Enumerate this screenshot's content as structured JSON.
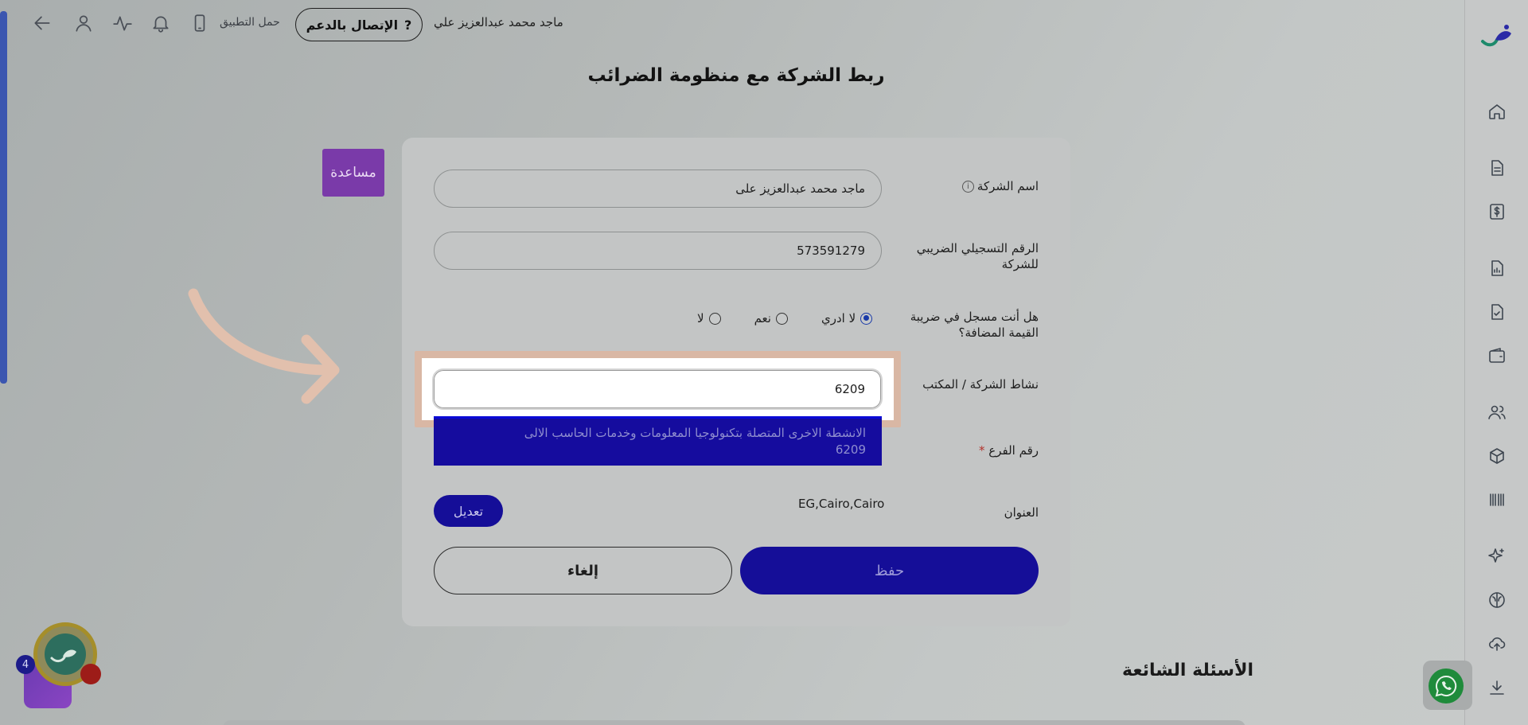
{
  "topbar": {
    "user_name": "ماجد محمد عبدالعزيز علي",
    "support_label": "الإتصال بالدعم",
    "support_icon": "?",
    "download_app_label": "حمل التطبيق"
  },
  "page": {
    "title": "ربط الشركة مع منظومة الضرائب",
    "help_label": "مساعدة"
  },
  "form": {
    "company_name_label": "اسم الشركة",
    "company_name_value": "ماجد محمد عبدالعزيز على",
    "tax_number_label_1": "الرقم التسجيلي الضريبي",
    "tax_number_label_2": "للشركة",
    "tax_number_value": "573591279",
    "vat_label_1": "هل أنت مسجل في ضريبة",
    "vat_label_2": "القيمة المضافة؟",
    "vat_options": [
      "لا ادري",
      "نعم",
      "لا"
    ],
    "vat_selected": "لا ادري",
    "activity_label": "نشاط الشركة / المكتب",
    "activity_value": "6209",
    "activity_option_text": "الانشطة الاخرى المتصلة بتكنولوجيا المعلومات وخدمات الحاسب الالى",
    "activity_option_code": "6209",
    "branch_label": "رقم الفرع",
    "required_mark": "*",
    "address_label": "العنوان",
    "address_value": "EG,Cairo,Cairo",
    "edit_label": "تعديل",
    "save_label": "حفظ",
    "cancel_label": "إلغاء"
  },
  "faq": {
    "title": "الأسئلة الشائعة"
  },
  "assistant": {
    "badge_count": "4"
  },
  "colors": {
    "primary": "#150e98",
    "help_purple": "#7a3aa9",
    "highlight": "#d9b7a4",
    "whatsapp": "#1f8b3b"
  },
  "icons": {
    "sidebar": [
      "logo",
      "home-icon",
      "document-icon",
      "invoice-dollar-icon",
      "report-icon",
      "checklist-icon",
      "wallet-icon",
      "users-icon",
      "box-icon",
      "barcode-icon",
      "sparkle-icon",
      "brain-icon",
      "upload-icon",
      "download-icon"
    ],
    "topbar": [
      "back-arrow-icon",
      "user-icon",
      "activity-icon",
      "bell-icon",
      "phone-icon"
    ]
  }
}
